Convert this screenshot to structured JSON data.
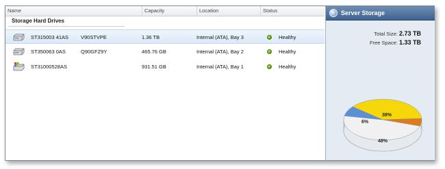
{
  "table": {
    "columns": [
      "Name",
      "Capacity",
      "Location",
      "Status"
    ],
    "group_title": "Storage Hard Drives",
    "rows": [
      {
        "name": "ST315003 41AS",
        "serial": "V90STVPE",
        "capacity": "1.36 TB",
        "location": "Internal (ATA), Bay 3",
        "status": "Healthy",
        "icon": "hard-drive-icon",
        "selected": true
      },
      {
        "name": "ST350063 0AS",
        "serial": "Q90GFZ9Y",
        "capacity": "465.76 GB",
        "location": "Internal (ATA), Bay 2",
        "status": "Healthy",
        "icon": "hard-drive-icon",
        "selected": false
      },
      {
        "name": "ST31000528AS",
        "serial": "",
        "capacity": "931.51 GB",
        "location": "Internal (ATA), Bay 1",
        "status": "Healthy",
        "icon": "system-drive-icon",
        "selected": false
      }
    ]
  },
  "side": {
    "title": "Server Storage",
    "total_label": "Total Size:",
    "total_value": "2.73 TB",
    "free_label": "Free Space:",
    "free_value": "1.33 TB"
  },
  "chart_data": {
    "type": "pie",
    "labels": [
      "38%",
      "6%",
      "48%"
    ],
    "values": [
      38,
      6,
      48,
      8
    ],
    "colors": [
      "#f6d80a",
      "#e07b1a",
      "#f1f1f1",
      "#5b8fd6"
    ]
  },
  "colors": {
    "header_blue": "#4a6c98",
    "status_ok": "#5b9b1a",
    "selected_row": "#dde9f6"
  }
}
